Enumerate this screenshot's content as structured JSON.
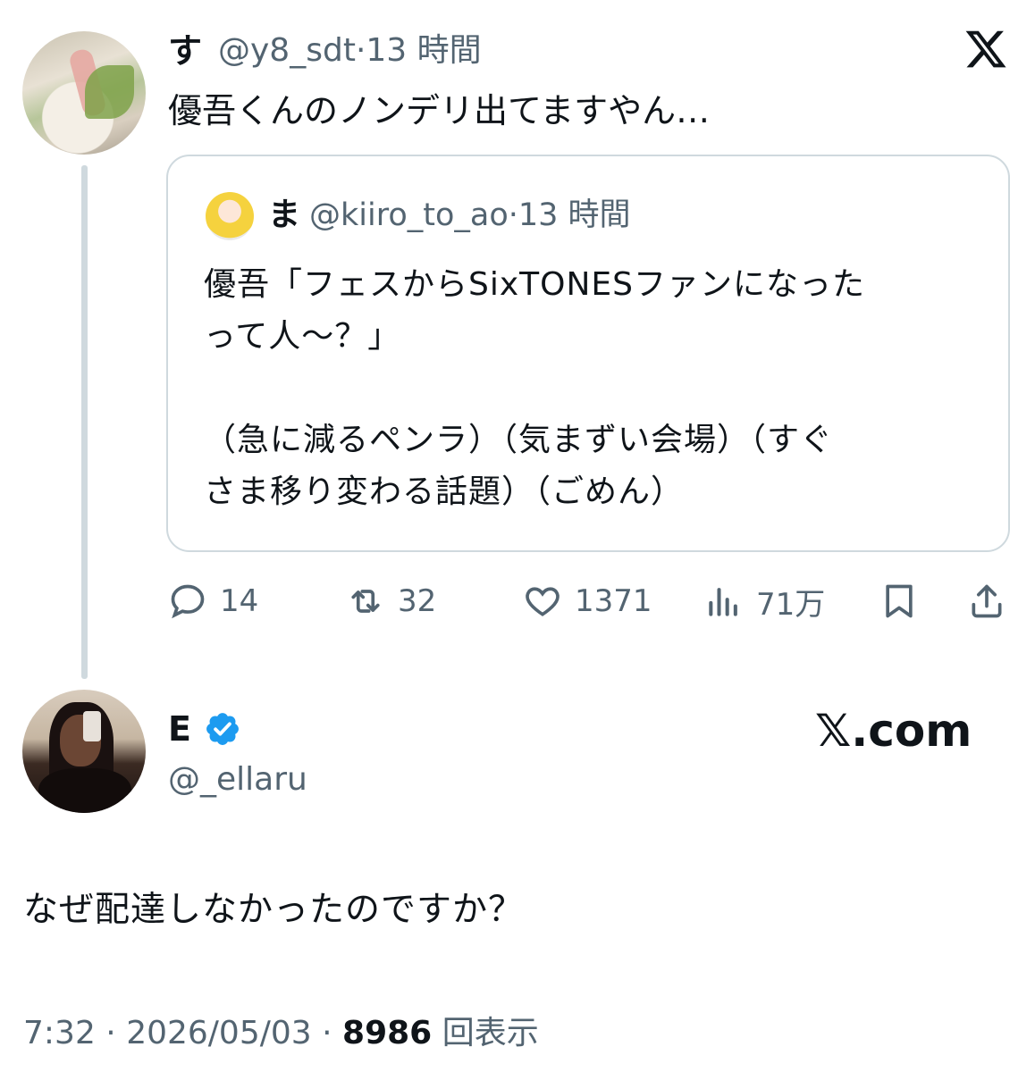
{
  "tweet": {
    "author": "す",
    "handle": "@y8_sdt",
    "time": "13 時間",
    "text": "優吾くんのノンデリ出てますやん…"
  },
  "quote": {
    "author": "ま",
    "handle": "@kiiro_to_ao",
    "time": "13 時間",
    "text": "優吾「フェスからSixTONESファンになった\nって人〜？」\n\n（急に減るペンラ）（気まずい会場）（すぐ\nさま移り変わる話題）（ごめん）"
  },
  "actions": {
    "replies": "14",
    "retweets": "32",
    "likes": "1371",
    "views": "71万"
  },
  "reply": {
    "author": "E",
    "handle": "@_ellaru",
    "text": "なぜ配達しなかったのですか？",
    "time": "7:32",
    "date": "2026/05/03",
    "views_count": "8986",
    "views_label": "回表示"
  },
  "brand": {
    "site": "𝕏.com",
    "accent": "#1d9bf0"
  },
  "icons": {
    "x_logo": "x-logo-icon",
    "verified": "verified-badge-icon",
    "reply": "reply-icon",
    "retweet": "retweet-icon",
    "like": "heart-icon",
    "views": "views-icon",
    "bookmark": "bookmark-icon",
    "share": "share-icon"
  }
}
